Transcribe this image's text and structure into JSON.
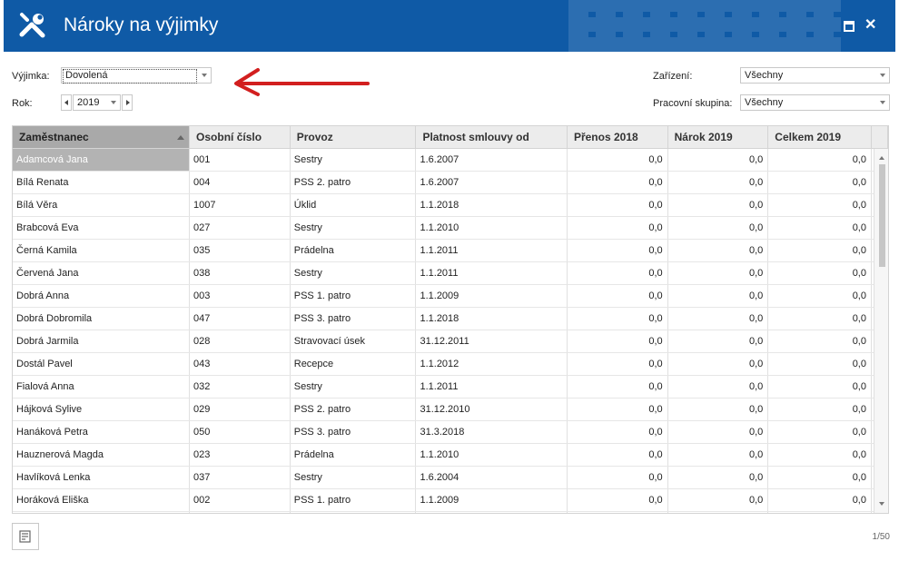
{
  "window": {
    "title": "Nároky na výjimky"
  },
  "filters": {
    "exception_label": "Výjimka:",
    "exception_value": "Dovolená",
    "year_label": "Rok:",
    "year_value": "2019",
    "facility_label": "Zařízení:",
    "facility_value": "Všechny",
    "workgroup_label": "Pracovní skupina:",
    "workgroup_value": "Všechny"
  },
  "annotation": {
    "arrow_color": "#d21f1f"
  },
  "table": {
    "columns": [
      "Zaměstnanec",
      "Osobní číslo",
      "Provoz",
      "Platnost smlouvy od",
      "Přenos 2018",
      "Nárok 2019",
      "Celkem 2019"
    ],
    "rows": [
      [
        "Adamcová Jana",
        "001",
        "Sestry",
        "1.6.2007",
        "0,0",
        "0,0",
        "0,0"
      ],
      [
        "Bílá Renata",
        "004",
        "PSS 2. patro",
        "1.6.2007",
        "0,0",
        "0,0",
        "0,0"
      ],
      [
        "Bílá Věra",
        "1007",
        "Úklid",
        "1.1.2018",
        "0,0",
        "0,0",
        "0,0"
      ],
      [
        "Brabcová Eva",
        "027",
        "Sestry",
        "1.1.2010",
        "0,0",
        "0,0",
        "0,0"
      ],
      [
        "Černá Kamila",
        "035",
        "Prádelna",
        "1.1.2011",
        "0,0",
        "0,0",
        "0,0"
      ],
      [
        "Červená Jana",
        "038",
        "Sestry",
        "1.1.2011",
        "0,0",
        "0,0",
        "0,0"
      ],
      [
        "Dobrá Anna",
        "003",
        "PSS 1. patro",
        "1.1.2009",
        "0,0",
        "0,0",
        "0,0"
      ],
      [
        "Dobrá Dobromila",
        "047",
        "PSS 3. patro",
        "1.1.2018",
        "0,0",
        "0,0",
        "0,0"
      ],
      [
        "Dobrá Jarmila",
        "028",
        "Stravovací úsek",
        "31.12.2011",
        "0,0",
        "0,0",
        "0,0"
      ],
      [
        "Dostál Pavel",
        "043",
        "Recepce",
        "1.1.2012",
        "0,0",
        "0,0",
        "0,0"
      ],
      [
        "Fialová Anna",
        "032",
        "Sestry",
        "1.1.2011",
        "0,0",
        "0,0",
        "0,0"
      ],
      [
        "Hájková Sylive",
        "029",
        "PSS 2. patro",
        "31.12.2010",
        "0,0",
        "0,0",
        "0,0"
      ],
      [
        "Hanáková Petra",
        "050",
        "PSS 3. patro",
        "31.3.2018",
        "0,0",
        "0,0",
        "0,0"
      ],
      [
        "Hauznerová Magda",
        "023",
        "Prádelna",
        "1.1.2010",
        "0,0",
        "0,0",
        "0,0"
      ],
      [
        "Havlíková Lenka",
        "037",
        "Sestry",
        "1.6.2004",
        "0,0",
        "0,0",
        "0,0"
      ],
      [
        "Horáková Eliška",
        "002",
        "PSS 1. patro",
        "1.1.2009",
        "0,0",
        "0,0",
        "0,0"
      ],
      [
        "",
        "",
        "",
        "",
        "",
        "",
        ""
      ]
    ]
  },
  "footer": {
    "pager": "1/50"
  },
  "colors": {
    "titlebar": "#0f5aa6",
    "selected_row": "#b3b3b3",
    "header_sorted": "#a9a9a9"
  },
  "icons": {
    "app": "wrench-screwdriver-icon",
    "maximize": "maximize-icon",
    "close": "close-icon",
    "footer": "document-list-icon"
  }
}
